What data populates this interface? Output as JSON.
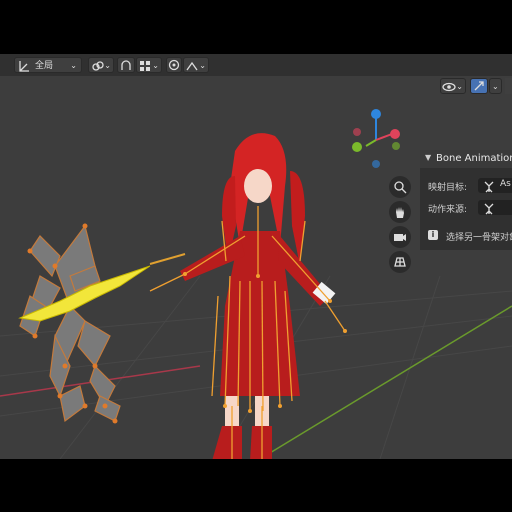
{
  "header": {
    "transform_orientation": "全局"
  },
  "npanel": {
    "title": "Bone Animation",
    "map_target_label": "映射目标:",
    "map_target_value": "As",
    "action_source_label": "动作来源:",
    "hint": "选择另一骨架对象"
  },
  "colors": {
    "viewport_bg": "#3d3d3d",
    "header_bg": "#303030",
    "accent_blue": "#4772b3",
    "axis_x": "#e0435b",
    "axis_y": "#7bba2b",
    "axis_z": "#2e86de",
    "bone_orange": "#f0a030",
    "bolt_yellow": "#f2e63a"
  },
  "icons": [
    "transform-orientation-icon",
    "link-icon",
    "snap-icon",
    "grid-snap-icon",
    "proportional-icon",
    "falloff-icon",
    "visibility-icon",
    "gizmo-icon",
    "zoom-icon",
    "hand-icon",
    "camera-icon",
    "grid-icon",
    "info-icon",
    "armature-icon"
  ]
}
